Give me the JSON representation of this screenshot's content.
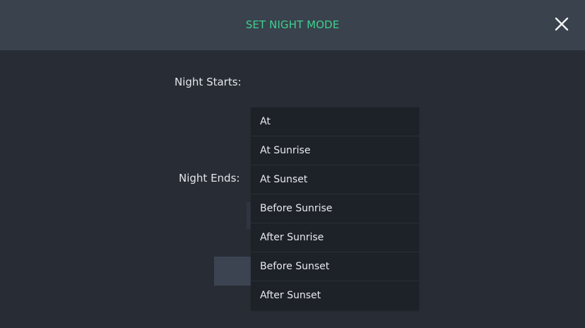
{
  "dialog": {
    "title": "SET NIGHT MODE",
    "close_icon": "close-icon",
    "accent_color": "#3fd08e"
  },
  "form": {
    "night_starts_label": "Night Starts:",
    "night_ends_label": "Night Ends:"
  },
  "dropdown": {
    "options": [
      "At",
      "At Sunrise",
      "At Sunset",
      "Before Sunrise",
      "After Sunrise",
      "Before Sunset",
      "After Sunset"
    ]
  }
}
